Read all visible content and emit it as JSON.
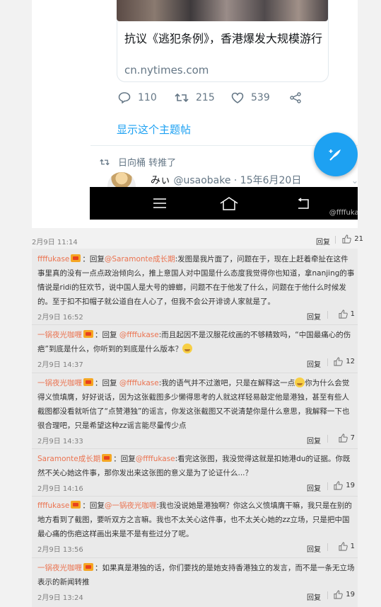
{
  "tweet": {
    "card_title": "抗议《逃犯条例》，香港爆发大规模游行",
    "card_domain": "cn.nytimes.com",
    "replies": "110",
    "retweets": "215",
    "likes": "539",
    "show_thread": "显示这个主题帖",
    "retweeted_by": "日向桶 转推了",
    "next_user_name": "みぃ",
    "next_user_handle": "@usaobake",
    "next_user_date": "· 15年6月20日",
    "watermark": "@ffffukase"
  },
  "post_meta": {
    "time": "2月9日 11:14",
    "reply": "回复",
    "likes": "21"
  },
  "comments": [
    {
      "user": "ffffukase",
      "reply_prefix": "：回复",
      "reply_to": "@Saramonte成长期",
      "text": ":发图是我片面了，问题在于，现在上赶着牵扯在这件事里真的没有一点点政治倾向么，推上意国人对中国是什么态度我觉得你也知道，拿nanjing的事情说是ridi的狂欢节，说中国人是大号的蟑螂，问题不在于他发了什么，问题在于他什么时候发的。至于扣不扣帽子就公道自在人心了，但我不会公开诽谤人家就是了。",
      "time": "2月9日 16:52",
      "reply": "回复",
      "likes": "1"
    },
    {
      "user": "一锅夜光咖喱",
      "reply_prefix": "：回复",
      "reply_to": "@ffffukase",
      "text": ":而且起因不是汉服花纹画的不够精致吗，“中国最痛心的伤疤”到底是什么，你听到的到底是什么版本？",
      "time": "2月9日 14:37",
      "reply": "回复",
      "likes": "12"
    },
    {
      "user": "一锅夜光咖喱",
      "reply_prefix": "：回复",
      "reply_to": "@ffffukase",
      "text_a": ":我的语气并不过激吧，只是在解释这一点",
      "text_b": "你为什么会觉得义愤填膺，好好说话，因为这张截图多少懒得思考的人就这样轻易敲定他是港独，甚至有些人截图都没看就听信了“点赞港独”的谣言，你发这张截图又不说清楚你是什么意思，我解释一下也很合理吧，只是希望这种zz谣言能尽量传少点",
      "time": "2月9日 14:33",
      "reply": "回复",
      "likes": "7"
    },
    {
      "user": "Saramonte成长期",
      "reply_prefix": "：回复",
      "reply_to": "@ffffukase",
      "text": ":看完这张图，我没觉得这就是扣她港du的证据。你既然不关心她这件事，那你发出来这张图的意义是为了论证什么...？",
      "time": "2月9日 14:16",
      "reply": "回复",
      "likes": "19"
    },
    {
      "user": "ffffukase",
      "reply_prefix": "：回复",
      "reply_to": "@一锅夜光咖喱",
      "text": ":我也没说她是港独啊？你这么义愤填膺干嘛，我只是在别的地方看到了截图，要听双方之言嘛。我也不太关心这件事，也不太关心她的zz立场，只是把中国最心痛的伤疤这样画出来是不是有些过分了呢。",
      "time": "2月9日 13:56",
      "reply": "回复",
      "likes": "1"
    },
    {
      "user": "一锅夜光咖喱",
      "reply_prefix": "",
      "reply_to": "",
      "text": "：如果真是港独的话，你们要找的是她支持香港独立的发言，而不是一条无立场表示的新闻转推",
      "time": "2月9日 13:24",
      "reply": "回复",
      "likes": "19"
    }
  ]
}
